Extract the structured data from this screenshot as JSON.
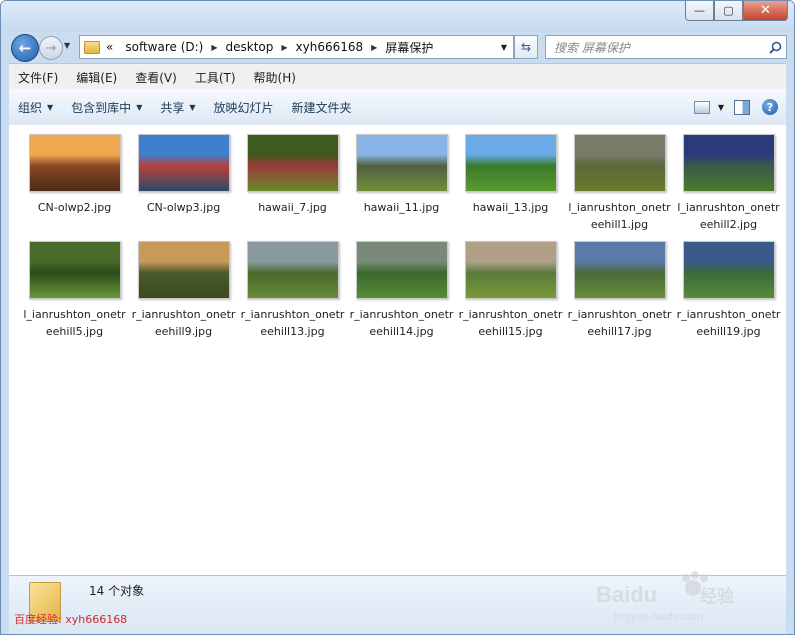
{
  "window": {
    "caption_min": "—",
    "caption_max": "▢",
    "caption_close": "✕"
  },
  "nav": {
    "back_glyph": "←",
    "forward_glyph": "→"
  },
  "address": {
    "overflow": "«",
    "crumbs": [
      "software (D:)",
      "desktop",
      "xyh666168",
      "屏幕保护"
    ]
  },
  "search": {
    "placeholder": "搜索 屏幕保护"
  },
  "menu": [
    "文件(F)",
    "编辑(E)",
    "查看(V)",
    "工具(T)",
    "帮助(H)"
  ],
  "toolbar": {
    "organize": "组织",
    "include": "包含到库中",
    "share": "共享",
    "slideshow": "放映幻灯片",
    "newfolder": "新建文件夹",
    "help": "?"
  },
  "files": [
    {
      "name": "CN-olwp2.jpg",
      "colors": [
        "#f0a850",
        "#8a4a25",
        "#4a2a18"
      ]
    },
    {
      "name": "CN-olwp3.jpg",
      "colors": [
        "#3f7fd0",
        "#b9403a",
        "#2a4a6a"
      ]
    },
    {
      "name": "hawaii_7.jpg",
      "colors": [
        "#3f5a1e",
        "#9a3a3a",
        "#6a8a2a"
      ]
    },
    {
      "name": "hawaii_11.jpg",
      "colors": [
        "#8ab4e6",
        "#506040",
        "#6f8f3a"
      ]
    },
    {
      "name": "hawaii_13.jpg",
      "colors": [
        "#6aaae8",
        "#3a7a2a",
        "#5a9a30"
      ]
    },
    {
      "name": "l_ianrushton_onetreehill1.jpg",
      "colors": [
        "#7a7a6a",
        "#5a6a3a",
        "#6a7a2a"
      ]
    },
    {
      "name": "l_ianrushton_onetreehill2.jpg",
      "colors": [
        "#2a3a7a",
        "#3a5a4a",
        "#4a7a2a"
      ]
    },
    {
      "name": "l_ianrushton_onetreehill5.jpg",
      "colors": [
        "#4a6a2a",
        "#2a4a1a",
        "#6a9a3a"
      ]
    },
    {
      "name": "r_ianrushton_onetreehill9.jpg",
      "colors": [
        "#c89a5a",
        "#4a5a2a",
        "#3a4a1a"
      ]
    },
    {
      "name": "r_ianrushton_onetreehill13.jpg",
      "colors": [
        "#8a9aa0",
        "#4a6a2a",
        "#6a8a3a"
      ]
    },
    {
      "name": "r_ianrushton_onetreehill14.jpg",
      "colors": [
        "#7a8a7a",
        "#3a6a2a",
        "#5a8a3a"
      ]
    },
    {
      "name": "r_ianrushton_onetreehill15.jpg",
      "colors": [
        "#b0a088",
        "#5a7a3a",
        "#7a9a3a"
      ]
    },
    {
      "name": "r_ianrushton_onetreehill17.jpg",
      "colors": [
        "#5a7aaa",
        "#4a6a3a",
        "#6a8a3a"
      ]
    },
    {
      "name": "r_ianrushton_onetreehill19.jpg",
      "colors": [
        "#3a5a8a",
        "#3a6a3a",
        "#5a8a3a"
      ]
    }
  ],
  "status": {
    "count": "14 个对象"
  },
  "watermark": {
    "text": "百度经验: xyh666168",
    "brand": "Baidu",
    "brand_cn": "经验",
    "url": "jingyan.baidu.com"
  }
}
